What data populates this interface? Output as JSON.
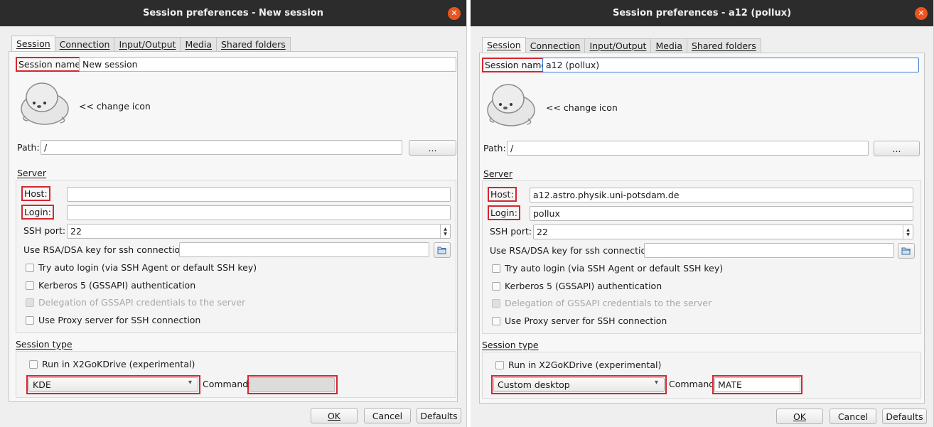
{
  "dialogs": [
    {
      "title": "Session preferences - New session",
      "close_glyph": "✕",
      "tabs": [
        "Session",
        "Connection",
        "Input/Output",
        "Media",
        "Shared folders"
      ],
      "active_tab": "Session",
      "session_name_label": "Session name:",
      "session_name_value": "New session",
      "session_icon": "seal-icon",
      "change_icon_label": "<< change icon",
      "path_label": "Path:",
      "path_value": "/",
      "browse_label": "...",
      "server": {
        "title": "Server",
        "host_label": "Host:",
        "host_value": "",
        "login_label": "Login:",
        "login_value": "",
        "ssh_port_label": "SSH port:",
        "ssh_port_value": "22",
        "rsa_label": "Use RSA/DSA key for ssh connection:",
        "rsa_value": "",
        "folder_icon": "folder-open-icon",
        "checkboxes": {
          "auto_login": "Try auto login (via SSH Agent or default SSH key)",
          "kerberos": "Kerberos 5 (GSSAPI) authentication",
          "delegation": "Delegation of GSSAPI credentials to the server",
          "proxy": "Use Proxy server for SSH connection"
        },
        "checked": {
          "auto_login": false,
          "kerberos": false,
          "delegation": false,
          "proxy": false
        }
      },
      "session_type": {
        "title": "Session type",
        "x2gokdrive_label": "Run in X2GoKDrive (experimental)",
        "x2gokdrive_checked": false,
        "type_value": "KDE",
        "command_label": "Command:",
        "command_value": ""
      },
      "buttons": {
        "ok": "OK",
        "cancel": "Cancel",
        "defaults": "Defaults"
      }
    },
    {
      "title": "Session preferences - a12 (pollux)",
      "close_glyph": "✕",
      "tabs": [
        "Session",
        "Connection",
        "Input/Output",
        "Media",
        "Shared folders"
      ],
      "active_tab": "Session",
      "session_name_label": "Session name:",
      "session_name_value": "a12 (pollux)",
      "session_icon": "seal-icon",
      "change_icon_label": "<< change icon",
      "path_label": "Path:",
      "path_value": "/",
      "browse_label": "...",
      "server": {
        "title": "Server",
        "host_label": "Host:",
        "host_value": "a12.astro.physik.uni-potsdam.de",
        "login_label": "Login:",
        "login_value": "pollux",
        "ssh_port_label": "SSH port:",
        "ssh_port_value": "22",
        "rsa_label": "Use RSA/DSA key for ssh connection:",
        "rsa_value": "",
        "folder_icon": "folder-open-icon",
        "checkboxes": {
          "auto_login": "Try auto login (via SSH Agent or default SSH key)",
          "kerberos": "Kerberos 5 (GSSAPI) authentication",
          "delegation": "Delegation of GSSAPI credentials to the server",
          "proxy": "Use Proxy server for SSH connection"
        },
        "checked": {
          "auto_login": false,
          "kerberos": false,
          "delegation": false,
          "proxy": false
        }
      },
      "session_type": {
        "title": "Session type",
        "x2gokdrive_label": "Run in X2GoKDrive (experimental)",
        "x2gokdrive_checked": false,
        "type_value": "Custom desktop",
        "command_label": "Command:",
        "command_value": "MATE"
      },
      "buttons": {
        "ok": "OK",
        "cancel": "Cancel",
        "defaults": "Defaults"
      }
    }
  ],
  "colors": {
    "highlight_box": "#d6262e",
    "titlebar": "#2c2c2c",
    "close_button": "#e95420",
    "focus_border": "#3a7bd5"
  }
}
